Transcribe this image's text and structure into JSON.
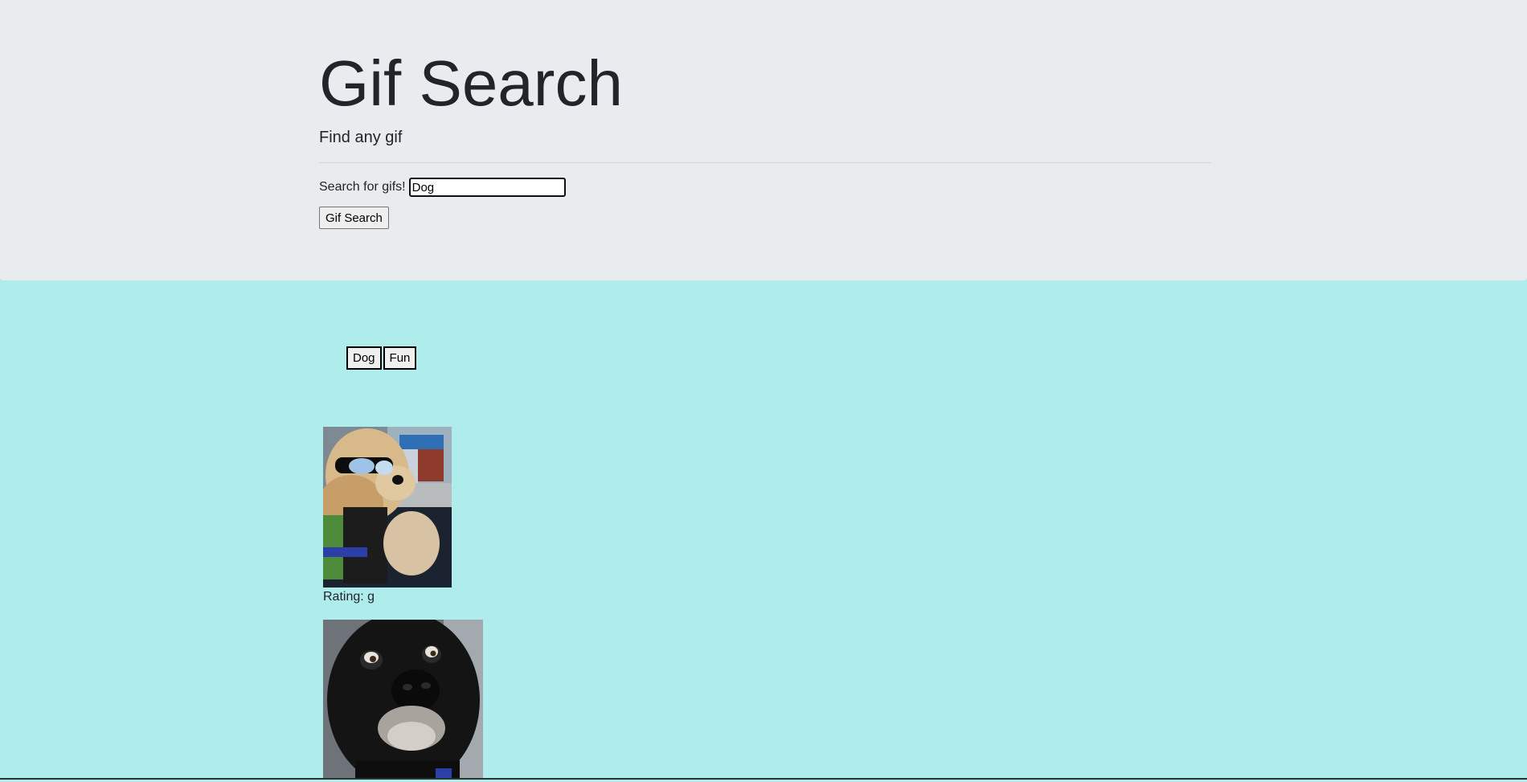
{
  "header": {
    "title": "Gif Search",
    "subtitle": "Find any gif"
  },
  "search": {
    "label": "Search for gifs!",
    "value": "Dog",
    "button_label": "Gif Search"
  },
  "tags": [
    {
      "label": "Dog"
    },
    {
      "label": "Fun"
    }
  ],
  "results": [
    {
      "image": "dog wearing sunglasses driving a car",
      "rating": "Rating: g"
    },
    {
      "image": "black dog with wide eyes",
      "rating": ""
    }
  ],
  "colors": {
    "header_bg": "#e9ecef",
    "page_bg": "#afecec"
  }
}
